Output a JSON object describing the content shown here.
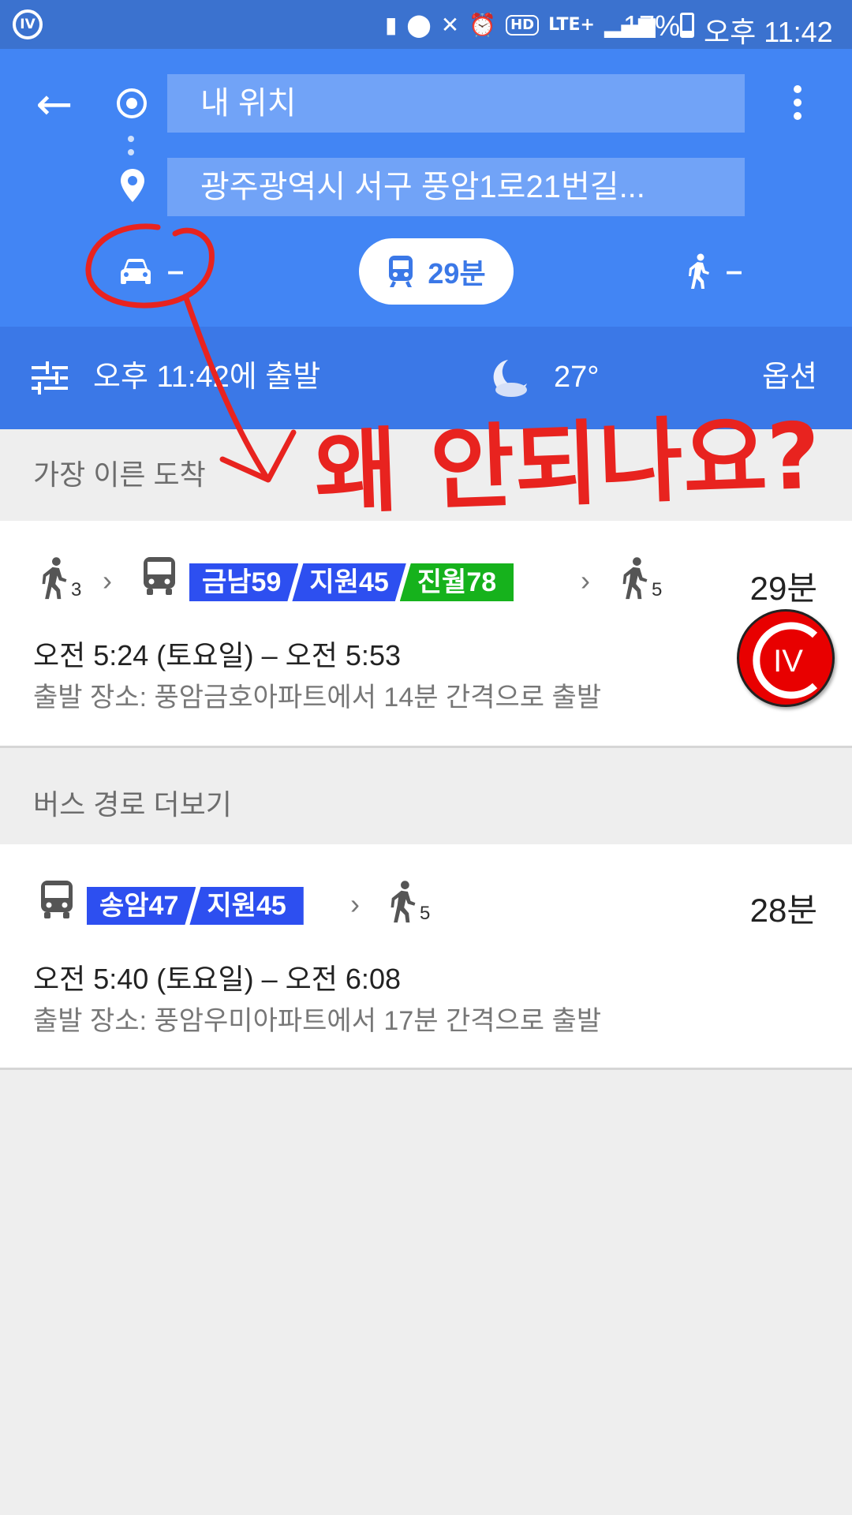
{
  "status_bar": {
    "battery_percent": "17%",
    "time": "오후 11:42",
    "network": "LTE+",
    "hd": "HD"
  },
  "search": {
    "origin": "내 위치",
    "destination": "광주광역시 서구 풍암1로21번길..."
  },
  "modes": {
    "drive": "–",
    "transit": "29분",
    "walk": "–"
  },
  "options_bar": {
    "depart": "오후 11:42에 출발",
    "temperature": "27°",
    "options_label": "옵션"
  },
  "sections": {
    "earliest_arrival": "가장 이른 도착",
    "more_bus_routes": "버스 경로 더보기"
  },
  "routes": [
    {
      "walk_before": "3",
      "lines": [
        "금남59",
        "지원45",
        "진월78"
      ],
      "line_colors": [
        "#2d4ff0",
        "#2d4ff0",
        "#16b21c"
      ],
      "walk_after": "5",
      "duration": "29분",
      "times": "오전 5:24 (토요일) – 오전 5:53",
      "departure": "출발 장소: 풍암금호아파트에서 14분 간격으로 출발"
    },
    {
      "lines": [
        "송암47",
        "지원45"
      ],
      "line_colors": [
        "#2d4ff0",
        "#2d4ff0"
      ],
      "walk_after": "5",
      "duration": "28분",
      "times": "오전 5:40 (토요일) – 오전 6:08",
      "departure": "출발 장소: 풍암우미아파트에서 17분 간격으로 출발"
    }
  ],
  "annotation": {
    "text": "왜 안되나요?",
    "color": "#e8231f"
  },
  "watermark": {
    "text": "IV"
  }
}
